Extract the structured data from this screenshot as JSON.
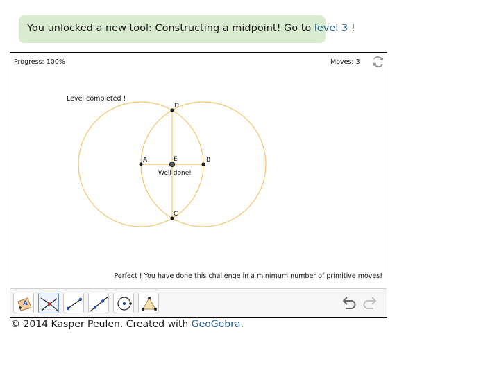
{
  "banner": {
    "text_before": "You unlocked a new tool: Constructing a midpoint! Go to ",
    "link": "level 3",
    "text_after": " !"
  },
  "applet": {
    "progress": "Progress: 100%",
    "moves": "Moves: 3",
    "level_completed": "Level completed !",
    "well_done": "Well done!",
    "perfect_message": "Perfect ! You have done this challenge in a minimum number of primitive moves!",
    "points": {
      "a": "A",
      "b": "B",
      "c": "C",
      "d": "D",
      "e": "E"
    },
    "toolbar": {
      "tools": [
        "move-tool",
        "intersect-tool",
        "segment-tool",
        "line-tool",
        "circle-tool",
        "polygon-tool"
      ],
      "selected_tool": "intersect-tool"
    },
    "colors": {
      "construction": "#f5c66b",
      "point": "#1a1a1a",
      "selected": "#6a8ec9"
    }
  },
  "footer": {
    "text_before": "© 2014 Kasper Peulen. Created with ",
    "link": "GeoGebra",
    "text_after": "."
  }
}
